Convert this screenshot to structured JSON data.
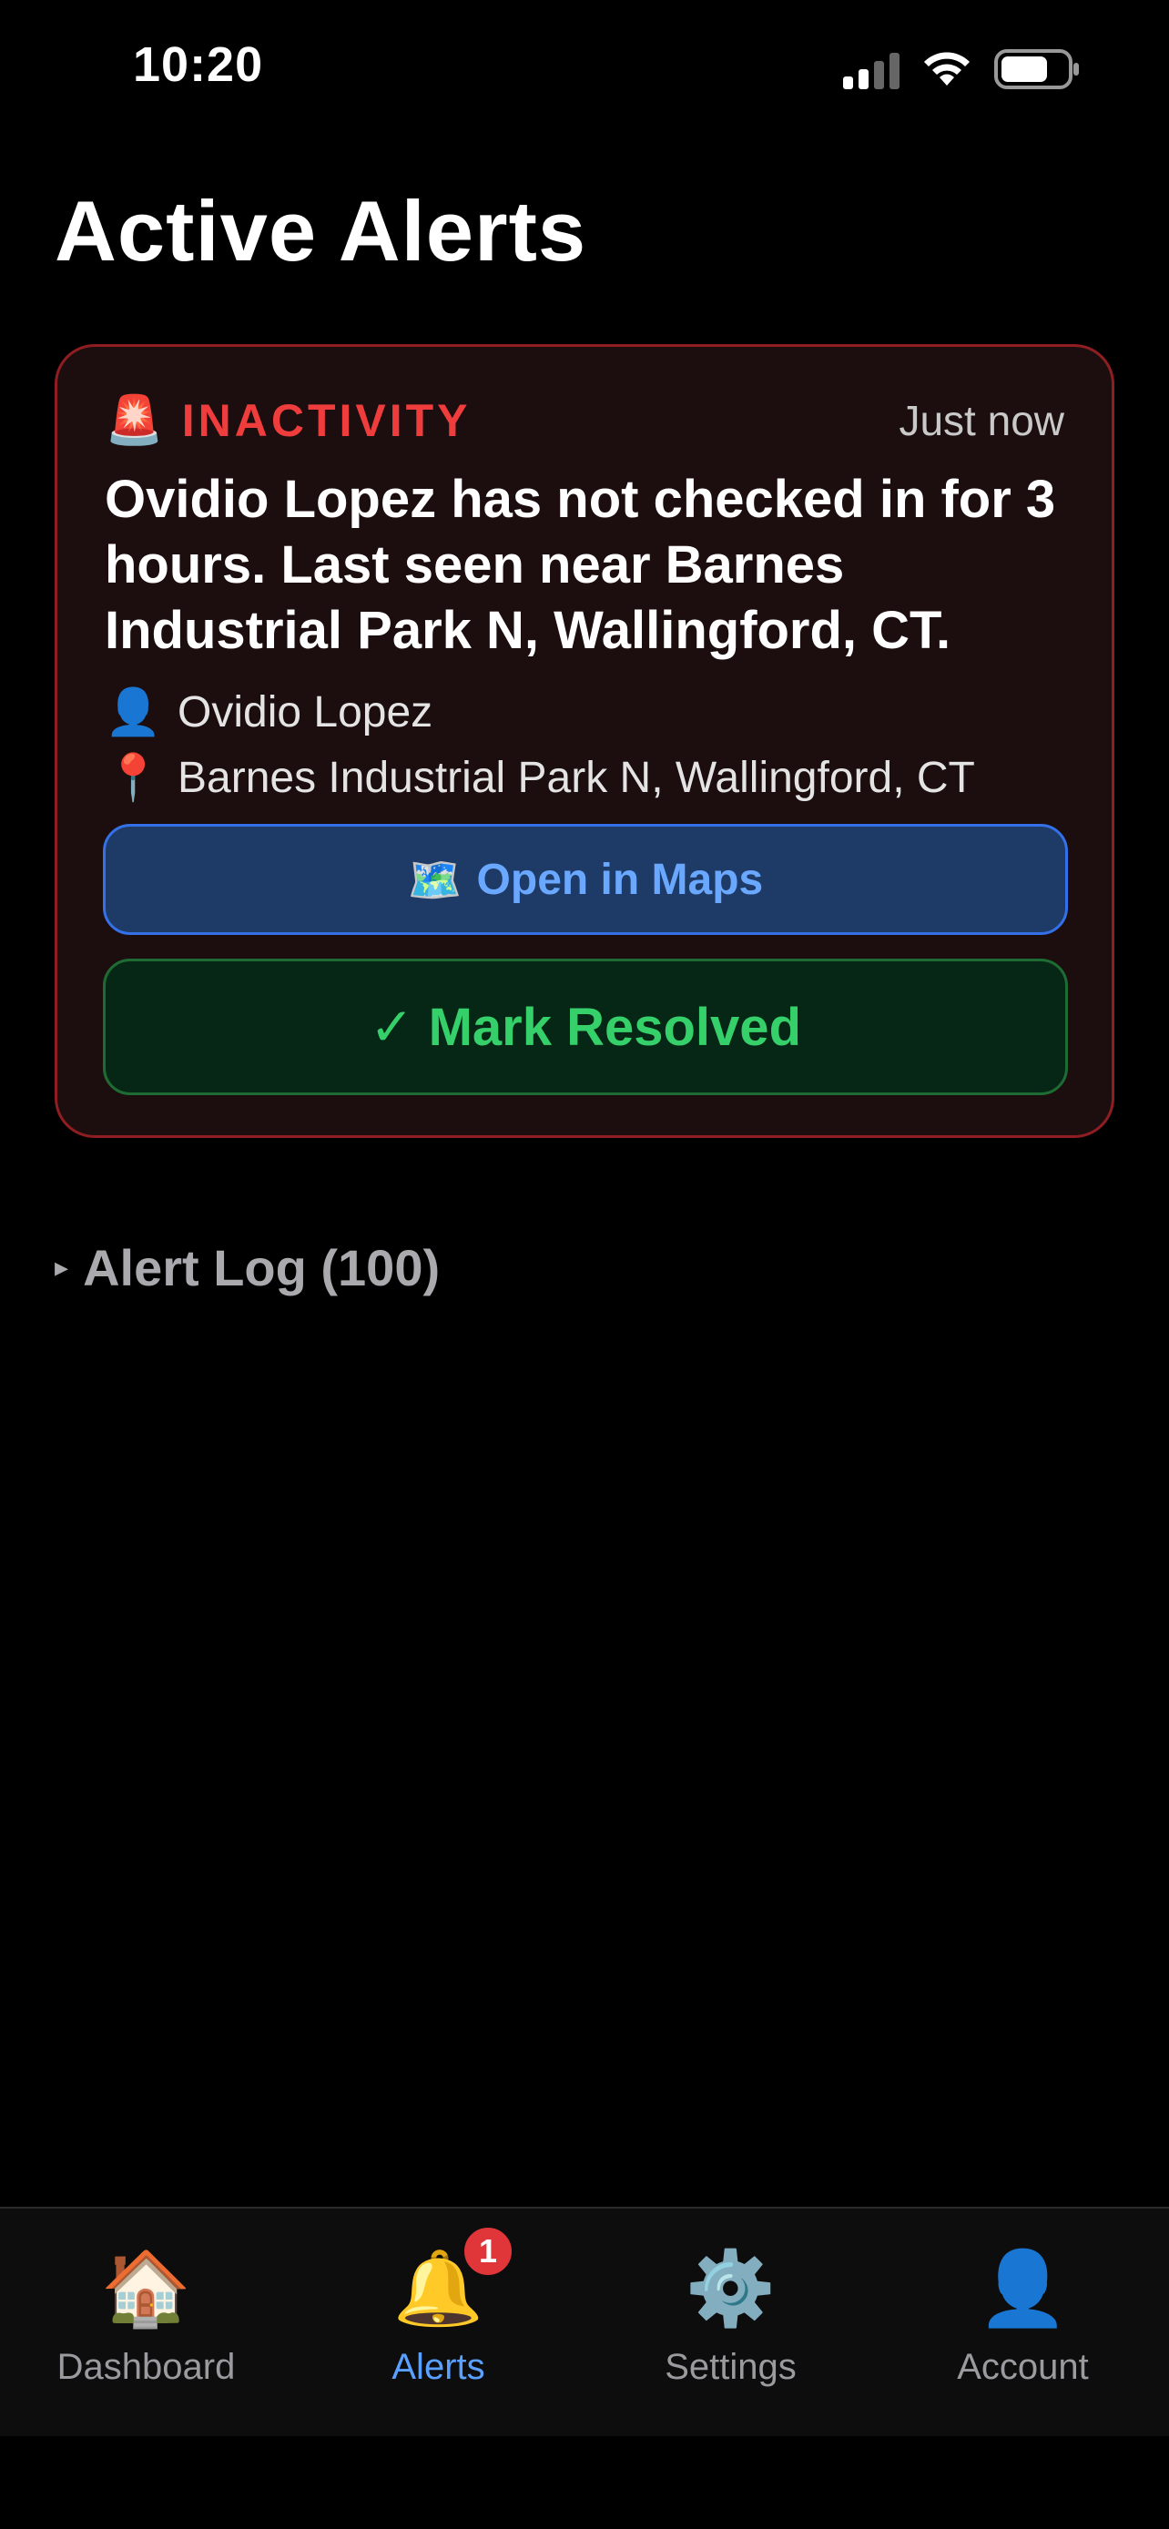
{
  "status_bar": {
    "time": "10:20"
  },
  "page": {
    "title": "Active Alerts"
  },
  "alert": {
    "type_icon": "🚨",
    "type": "INACTIVITY",
    "time": "Just now",
    "message": "Ovidio Lopez has not checked in for 3 hours. Last seen near Barnes Industrial Park N, Wallingford, CT.",
    "person_icon": "👤",
    "person": "Ovidio Lopez",
    "location_icon": "📍",
    "location": "Barnes Industrial Park N, Wallingford, CT",
    "maps_button": {
      "icon": "🗺️",
      "label": "Open in Maps"
    },
    "resolve_button": {
      "icon": "✓",
      "label": "Mark Resolved"
    }
  },
  "alert_log": {
    "caret": "▸",
    "label": "Alert Log (100)"
  },
  "tab_bar": {
    "tabs": [
      {
        "icon": "🏠",
        "label": "Dashboard"
      },
      {
        "icon": "🔔",
        "label": "Alerts",
        "badge": "1"
      },
      {
        "icon": "⚙️",
        "label": "Settings"
      },
      {
        "icon": "👤",
        "label": "Account"
      }
    ],
    "active": "Alerts"
  },
  "colors": {
    "alert_accent": "#ef3c3c",
    "maps_accent": "#6aa8ff",
    "resolve_accent": "#35d06a",
    "active_tab": "#5aa0ff"
  }
}
